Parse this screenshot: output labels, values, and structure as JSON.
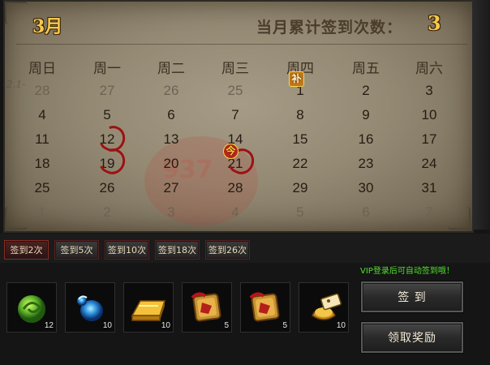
{
  "calendar": {
    "month": "3月",
    "total_label": "当月累计签到次数：",
    "total_value": "3",
    "weekdays": [
      "周日",
      "周一",
      "周二",
      "周三",
      "周四",
      "周五",
      "周六"
    ],
    "weeks": [
      [
        "28",
        "27",
        "26",
        "25",
        "1",
        "2",
        "3"
      ],
      [
        "4",
        "5",
        "6",
        "7",
        "8",
        "9",
        "10"
      ],
      [
        "11",
        "12",
        "13",
        "14",
        "15",
        "16",
        "17"
      ],
      [
        "18",
        "19",
        "20",
        "21",
        "22",
        "23",
        "24"
      ],
      [
        "25",
        "26",
        "27",
        "28",
        "29",
        "30",
        "31"
      ],
      [
        "1",
        "2",
        "3",
        "4",
        "5",
        "6",
        "7"
      ]
    ],
    "today_badge": "今",
    "makeup_badge": "补",
    "watermark": "937",
    "scribble": "-2.1-"
  },
  "milestones": [
    "签到2次",
    "签到5次",
    "签到10次",
    "签到18次",
    "签到26次"
  ],
  "vip_note": "VIP登录后可自动签到哦！",
  "rewards": [
    {
      "icon": "green-orb-icon",
      "count": "12"
    },
    {
      "icon": "blue-gem-icon",
      "count": "10"
    },
    {
      "icon": "gold-bar-icon",
      "count": "10"
    },
    {
      "icon": "red-token-icon",
      "count": "5"
    },
    {
      "icon": "red-token-icon",
      "count": "5"
    },
    {
      "icon": "gold-ingot-icon",
      "count": "10"
    }
  ],
  "actions": {
    "checkin_label": "签 到",
    "claim_label": "领取奖励"
  },
  "colors": {
    "accent_gold": "#f5c94a",
    "mark_red": "#9b1212",
    "vip_green": "#51e02d"
  }
}
